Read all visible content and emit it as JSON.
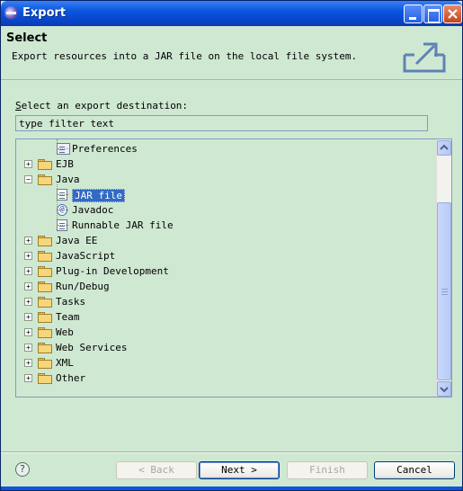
{
  "window": {
    "title": "Export",
    "icon": "eclipse-icon",
    "controls": [
      "minimize",
      "maximize",
      "close"
    ]
  },
  "header": {
    "title": "Select",
    "description": "Export resources into a JAR file on the local file system.",
    "graphic": "export-wizard-icon"
  },
  "destination": {
    "label_prefix": "S",
    "label_rest": "elect an export destination:"
  },
  "filter": {
    "value": "type filter text"
  },
  "tree": {
    "items": [
      {
        "label": "Preferences",
        "level": 1,
        "icon": "preferences-icon",
        "expander": ""
      },
      {
        "label": "EJB",
        "level": 0,
        "icon": "folder-icon",
        "expander": "+"
      },
      {
        "label": "Java",
        "level": 0,
        "icon": "folder-icon",
        "expander": "−"
      },
      {
        "label": "JAR file",
        "level": 1,
        "icon": "jar-file-icon",
        "expander": "",
        "selected": true
      },
      {
        "label": "Javadoc",
        "level": 1,
        "icon": "javadoc-icon",
        "expander": ""
      },
      {
        "label": "Runnable JAR file",
        "level": 1,
        "icon": "runnable-jar-icon",
        "expander": ""
      },
      {
        "label": "Java EE",
        "level": 0,
        "icon": "folder-icon",
        "expander": "+"
      },
      {
        "label": "JavaScript",
        "level": 0,
        "icon": "folder-icon",
        "expander": "+"
      },
      {
        "label": "Plug-in Development",
        "level": 0,
        "icon": "folder-icon",
        "expander": "+"
      },
      {
        "label": "Run/Debug",
        "level": 0,
        "icon": "folder-icon",
        "expander": "+"
      },
      {
        "label": "Tasks",
        "level": 0,
        "icon": "folder-icon",
        "expander": "+"
      },
      {
        "label": "Team",
        "level": 0,
        "icon": "folder-icon",
        "expander": "+"
      },
      {
        "label": "Web",
        "level": 0,
        "icon": "folder-icon",
        "expander": "+"
      },
      {
        "label": "Web Services",
        "level": 0,
        "icon": "folder-icon",
        "expander": "+"
      },
      {
        "label": "XML",
        "level": 0,
        "icon": "folder-icon",
        "expander": "+"
      },
      {
        "label": "Other",
        "level": 0,
        "icon": "folder-icon",
        "expander": "+"
      }
    ]
  },
  "buttons": {
    "help": "?",
    "back": "< Back",
    "next": "Next >",
    "finish": "Finish",
    "cancel": "Cancel"
  },
  "colors": {
    "titlebar": "#0a56e0",
    "background": "#cfe8d2",
    "selection": "#316ac5"
  }
}
